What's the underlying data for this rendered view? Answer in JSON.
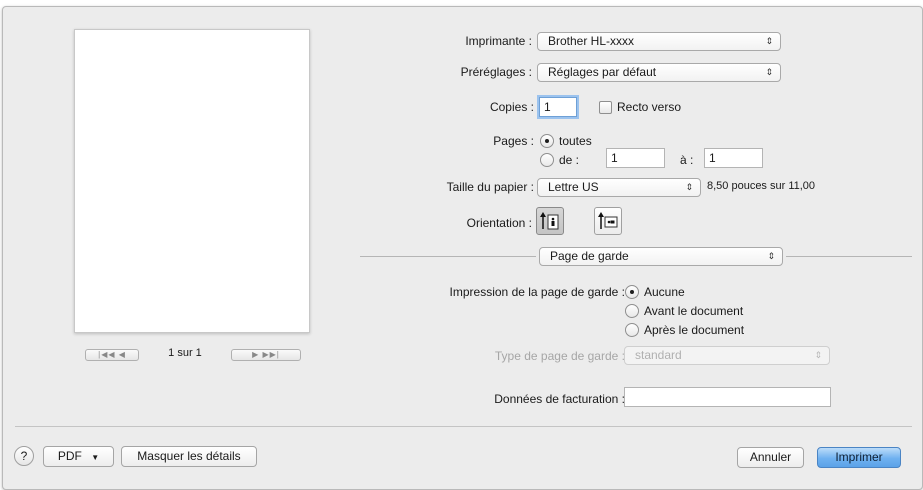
{
  "preview": {
    "page_counter": "1 sur 1"
  },
  "form": {
    "printer": {
      "label": "Imprimante :",
      "value": "Brother HL-xxxx"
    },
    "presets": {
      "label": "Préréglages :",
      "value": "Réglages par défaut"
    },
    "copies": {
      "label": "Copies :",
      "value": "1"
    },
    "duplex": {
      "label": "Recto verso",
      "checked": false
    },
    "pages": {
      "label": "Pages :",
      "all_label": "toutes",
      "from_label": "de :",
      "from_value": "1",
      "to_label": "à :",
      "to_value": "1",
      "selected": "all"
    },
    "paper_size": {
      "label": "Taille du papier :",
      "value": "Lettre US",
      "dimensions": "8,50 pouces sur 11,00"
    },
    "orientation": {
      "label": "Orientation :",
      "selected": "portrait"
    },
    "section": {
      "value": "Page de garde"
    },
    "cover_page": {
      "label": "Impression de la page de garde :",
      "options": [
        "Aucune",
        "Avant le document",
        "Après le document"
      ],
      "selected_index": 0
    },
    "cover_type": {
      "label": "Type de page de garde :",
      "value": "standard"
    },
    "billing": {
      "label": "Données de facturation :",
      "value": ""
    }
  },
  "footer": {
    "help": "?",
    "pdf_label": "PDF",
    "hide_details": "Masquer les détails",
    "cancel": "Annuler",
    "print": "Imprimer"
  }
}
